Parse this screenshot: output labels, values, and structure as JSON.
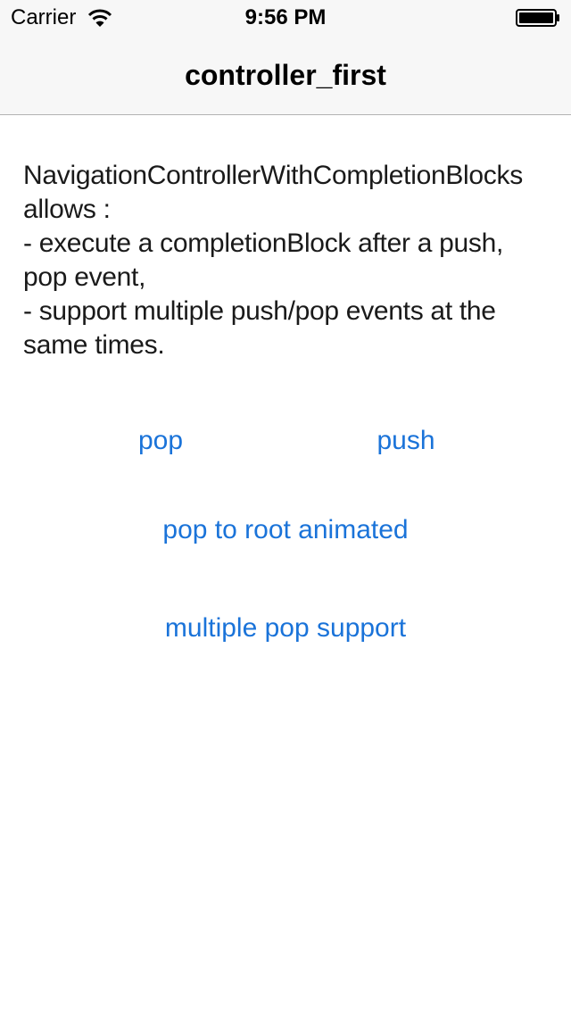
{
  "status_bar": {
    "carrier": "Carrier",
    "time": "9:56 PM",
    "wifi_icon": "wifi-icon",
    "battery_icon": "battery-full-icon"
  },
  "nav_bar": {
    "title": "controller_first"
  },
  "description": "NavigationControllerWithCompletionBlocks\nallows :\n- execute a completionBlock after a push,\npop event,\n- support multiple push/pop events at the\nsame times.",
  "buttons": {
    "pop": "pop",
    "push": "push",
    "pop_to_root": "pop to root animated",
    "multiple_pop": "multiple pop support"
  },
  "colors": {
    "accent": "#1a73d9",
    "bar_background": "#f7f7f7"
  }
}
